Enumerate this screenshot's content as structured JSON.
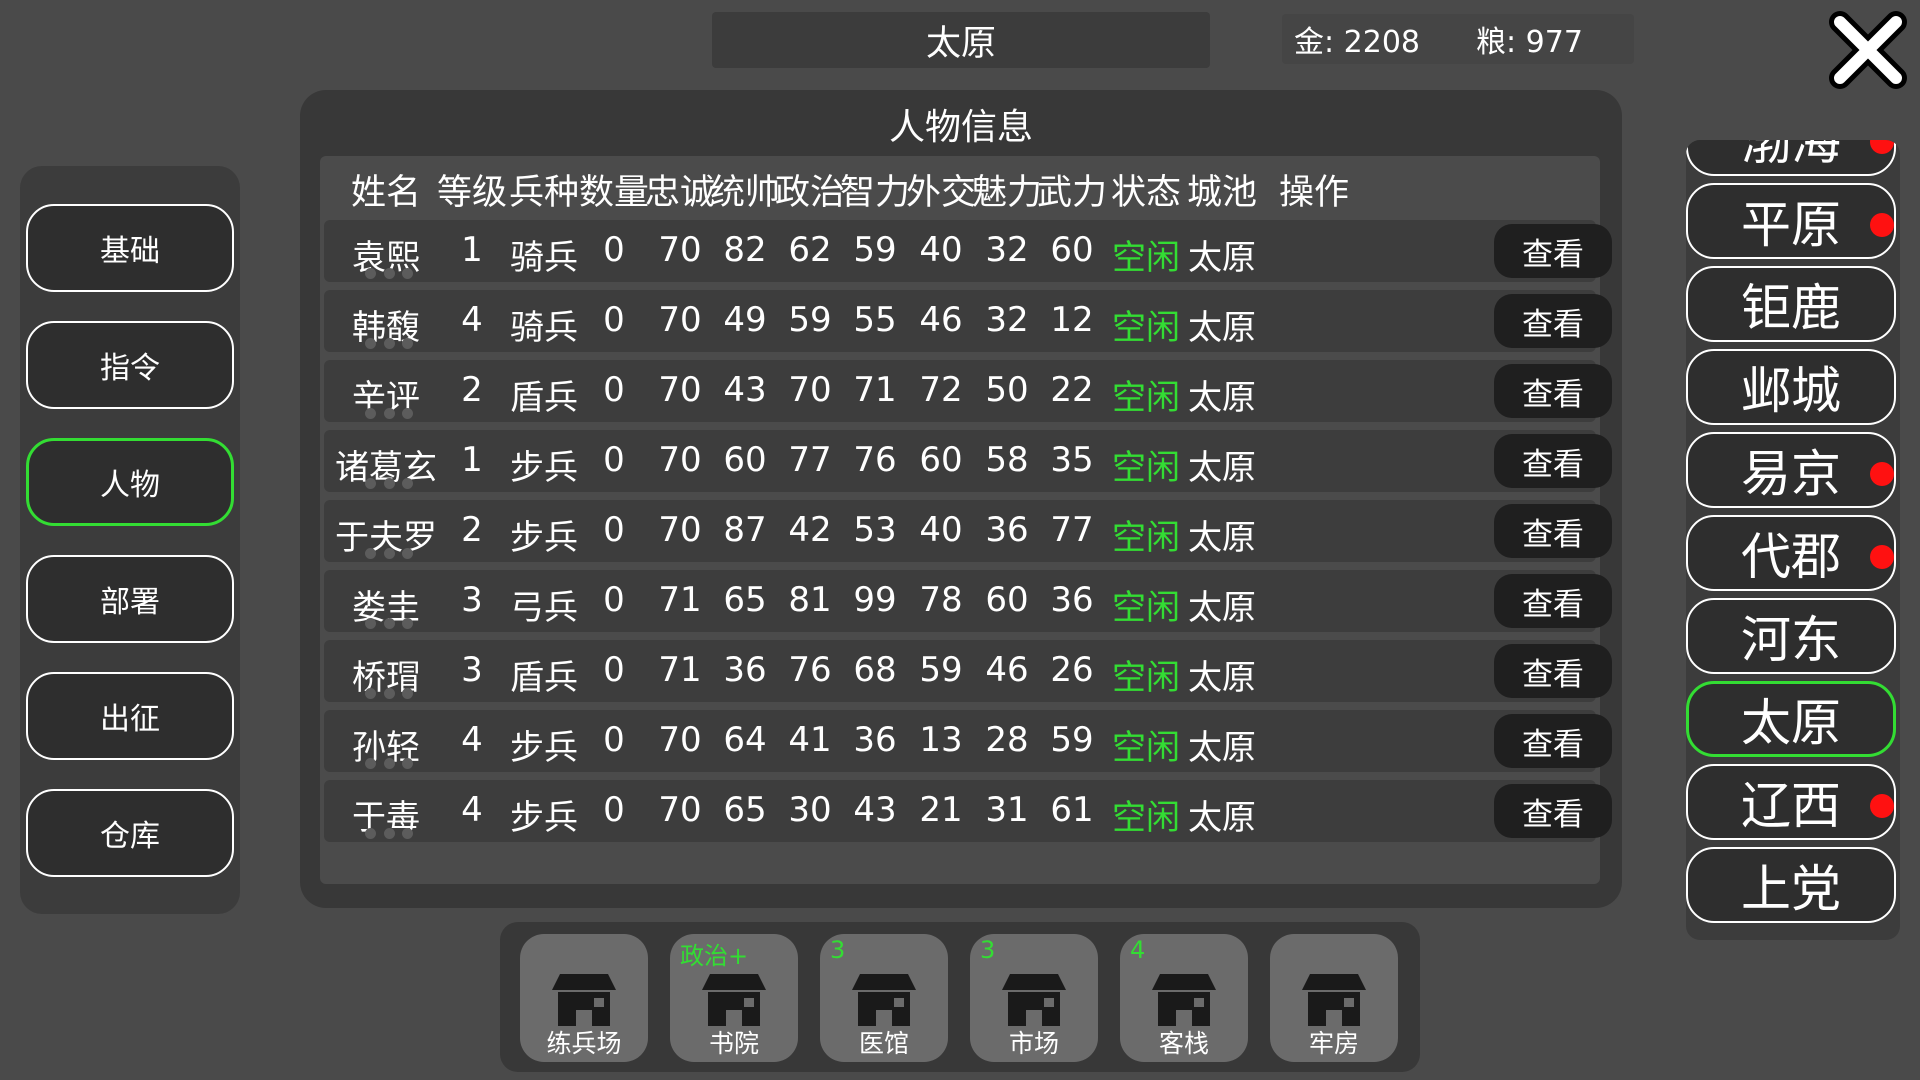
{
  "top_bar": {
    "city_name": "太原",
    "gold": "金: 2208",
    "grain": "粮: 977"
  },
  "left_menu": {
    "items": [
      {
        "label": "基础",
        "active": false
      },
      {
        "label": "指令",
        "active": false
      },
      {
        "label": "人物",
        "active": true
      },
      {
        "label": "部署",
        "active": false
      },
      {
        "label": "出征",
        "active": false
      },
      {
        "label": "仓库",
        "active": false
      }
    ]
  },
  "panel": {
    "title": "人物信息",
    "columns": [
      "姓名",
      "等级",
      "兵种",
      "数量",
      "忠诚",
      "统帅",
      "政治",
      "智力",
      "外交",
      "魅力",
      "武力",
      "状态",
      "城池",
      "操作"
    ],
    "rows": [
      {
        "name": "袁熙",
        "level": "1",
        "troop": "骑兵",
        "count": "0",
        "loyalty": "70",
        "lead": "82",
        "politics": "62",
        "intel": "59",
        "diplomacy": "40",
        "charm": "32",
        "force": "60",
        "status": "空闲",
        "city": "太原",
        "action": "查看"
      },
      {
        "name": "韩馥",
        "level": "4",
        "troop": "骑兵",
        "count": "0",
        "loyalty": "70",
        "lead": "49",
        "politics": "59",
        "intel": "55",
        "diplomacy": "46",
        "charm": "32",
        "force": "12",
        "status": "空闲",
        "city": "太原",
        "action": "查看"
      },
      {
        "name": "辛评",
        "level": "2",
        "troop": "盾兵",
        "count": "0",
        "loyalty": "70",
        "lead": "43",
        "politics": "70",
        "intel": "71",
        "diplomacy": "72",
        "charm": "50",
        "force": "22",
        "status": "空闲",
        "city": "太原",
        "action": "查看"
      },
      {
        "name": "诸葛玄",
        "level": "1",
        "troop": "步兵",
        "count": "0",
        "loyalty": "70",
        "lead": "60",
        "politics": "77",
        "intel": "76",
        "diplomacy": "60",
        "charm": "58",
        "force": "35",
        "status": "空闲",
        "city": "太原",
        "action": "查看"
      },
      {
        "name": "于夫罗",
        "level": "2",
        "troop": "步兵",
        "count": "0",
        "loyalty": "70",
        "lead": "87",
        "politics": "42",
        "intel": "53",
        "diplomacy": "40",
        "charm": "36",
        "force": "77",
        "status": "空闲",
        "city": "太原",
        "action": "查看"
      },
      {
        "name": "娄圭",
        "level": "3",
        "troop": "弓兵",
        "count": "0",
        "loyalty": "71",
        "lead": "65",
        "politics": "81",
        "intel": "99",
        "diplomacy": "78",
        "charm": "60",
        "force": "36",
        "status": "空闲",
        "city": "太原",
        "action": "查看"
      },
      {
        "name": "桥瑁",
        "level": "3",
        "troop": "盾兵",
        "count": "0",
        "loyalty": "71",
        "lead": "36",
        "politics": "76",
        "intel": "68",
        "diplomacy": "59",
        "charm": "46",
        "force": "26",
        "status": "空闲",
        "city": "太原",
        "action": "查看"
      },
      {
        "name": "孙轻",
        "level": "4",
        "troop": "步兵",
        "count": "0",
        "loyalty": "70",
        "lead": "64",
        "politics": "41",
        "intel": "36",
        "diplomacy": "13",
        "charm": "28",
        "force": "59",
        "status": "空闲",
        "city": "太原",
        "action": "查看"
      },
      {
        "name": "于毒",
        "level": "4",
        "troop": "步兵",
        "count": "0",
        "loyalty": "70",
        "lead": "65",
        "politics": "30",
        "intel": "43",
        "diplomacy": "21",
        "charm": "31",
        "force": "61",
        "status": "空闲",
        "city": "太原",
        "action": "查看"
      }
    ]
  },
  "buildings": [
    {
      "name": "练兵场",
      "badge": ""
    },
    {
      "name": "书院",
      "badge": "政治+"
    },
    {
      "name": "医馆",
      "badge": "3"
    },
    {
      "name": "市场",
      "badge": "3"
    },
    {
      "name": "客栈",
      "badge": "4"
    },
    {
      "name": "牢房",
      "badge": ""
    }
  ],
  "city_list": [
    {
      "name": "渤海",
      "alert": true,
      "active": false
    },
    {
      "name": "平原",
      "alert": true,
      "active": false
    },
    {
      "name": "钜鹿",
      "alert": false,
      "active": false
    },
    {
      "name": "邺城",
      "alert": false,
      "active": false
    },
    {
      "name": "易京",
      "alert": true,
      "active": false
    },
    {
      "name": "代郡",
      "alert": true,
      "active": false
    },
    {
      "name": "河东",
      "alert": false,
      "active": false
    },
    {
      "name": "太原",
      "alert": false,
      "active": true
    },
    {
      "name": "辽西",
      "alert": true,
      "active": false
    },
    {
      "name": "上党",
      "alert": false,
      "active": false
    }
  ],
  "colors": {
    "status_idle": "#33dd33",
    "active_border": "#33dd33",
    "alert_dot": "#ff1111",
    "background": "#4a4a4a"
  },
  "icons": {
    "close": "close-x-icon",
    "building": "building-icon",
    "alert": "red-dot-icon"
  }
}
